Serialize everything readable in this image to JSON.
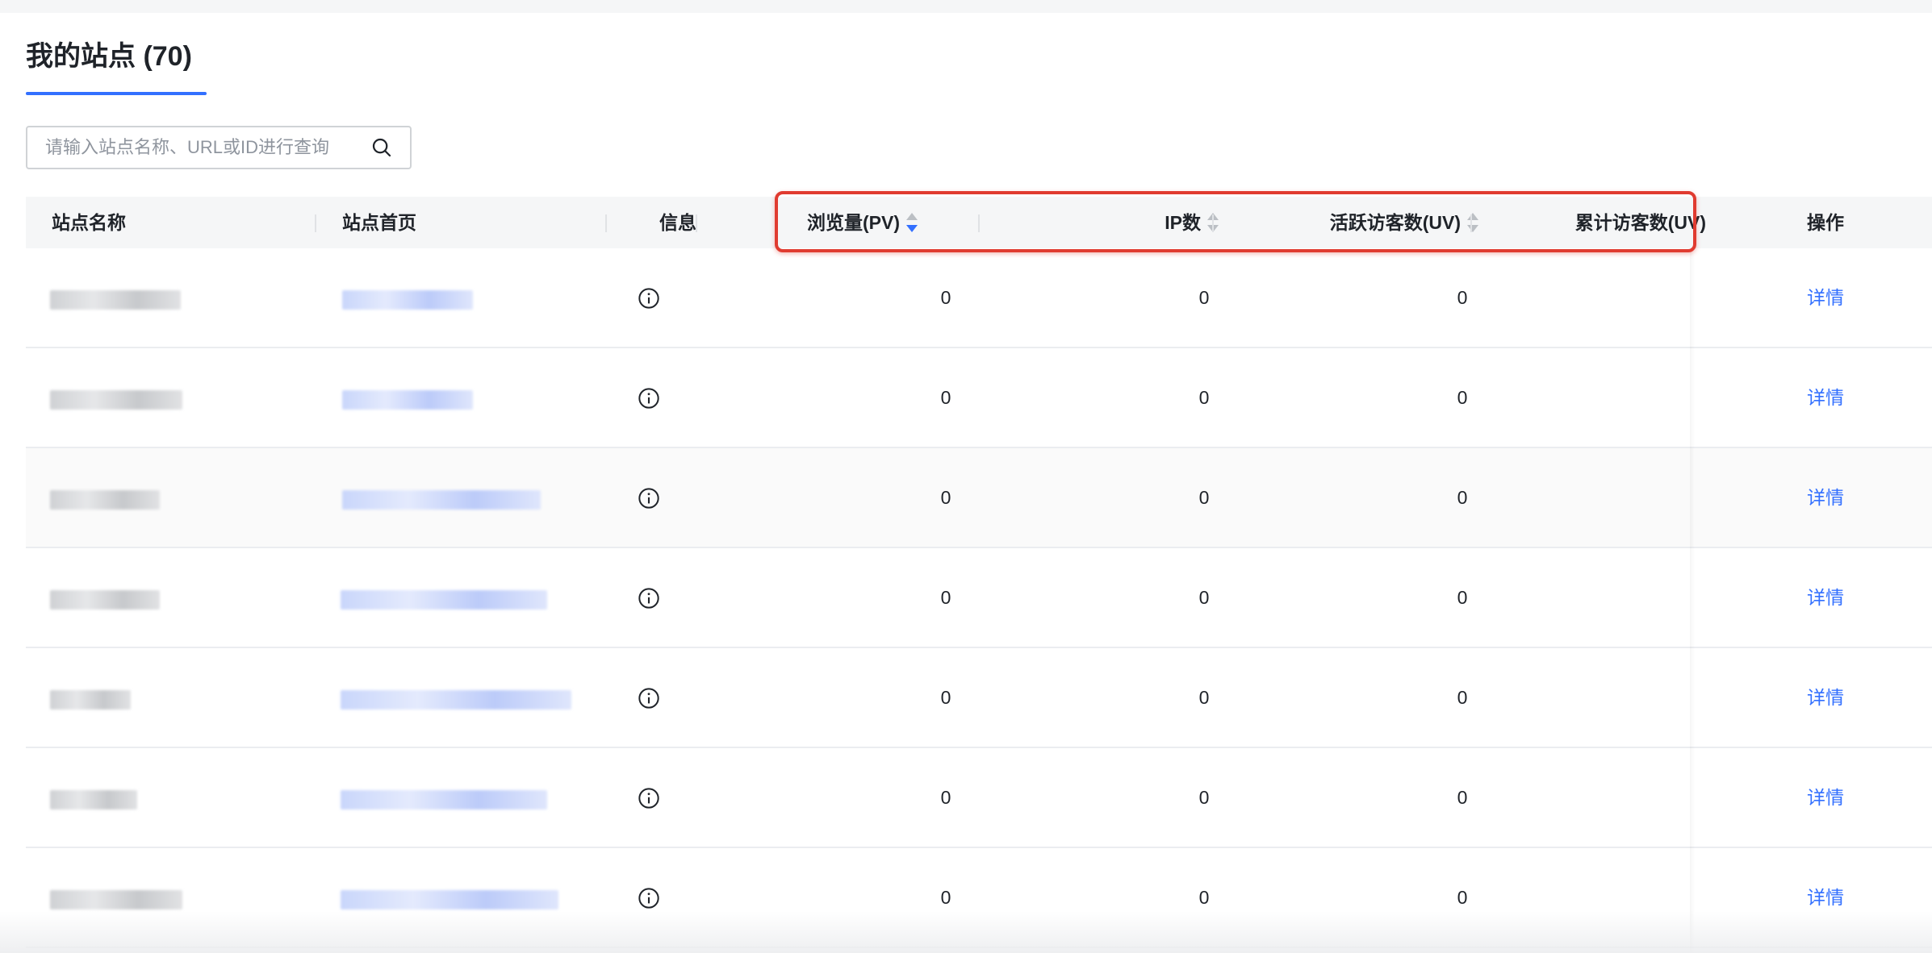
{
  "page": {
    "title": "我的站点 (70)"
  },
  "search": {
    "placeholder": "请输入站点名称、URL或ID进行查询",
    "value": "",
    "icon": "search-icon"
  },
  "table": {
    "columns": {
      "site_name": "站点名称",
      "homepage": "站点首页",
      "info": "信息",
      "pv": "浏览量(PV)",
      "ip": "IP数",
      "uv_active": "活跃访客数(UV)",
      "uv_total": "累计访客数(UV)",
      "action": "操作"
    },
    "rows": [
      {
        "pv": "0",
        "ip": "0",
        "uv_active": "0",
        "uv_total": "",
        "action": "详情"
      },
      {
        "pv": "0",
        "ip": "0",
        "uv_active": "0",
        "uv_total": "",
        "action": "详情"
      },
      {
        "pv": "0",
        "ip": "0",
        "uv_active": "0",
        "uv_total": "",
        "action": "详情"
      },
      {
        "pv": "0",
        "ip": "0",
        "uv_active": "0",
        "uv_total": "",
        "action": "详情"
      },
      {
        "pv": "0",
        "ip": "0",
        "uv_active": "0",
        "uv_total": "",
        "action": "详情"
      },
      {
        "pv": "0",
        "ip": "0",
        "uv_active": "0",
        "uv_total": "",
        "action": "详情"
      },
      {
        "pv": "0",
        "ip": "0",
        "uv_active": "0",
        "uv_total": "",
        "action": "详情"
      }
    ]
  },
  "colors": {
    "accent": "#3370ff",
    "highlight_border": "#e03b30",
    "header_bg": "#f5f6f7"
  }
}
